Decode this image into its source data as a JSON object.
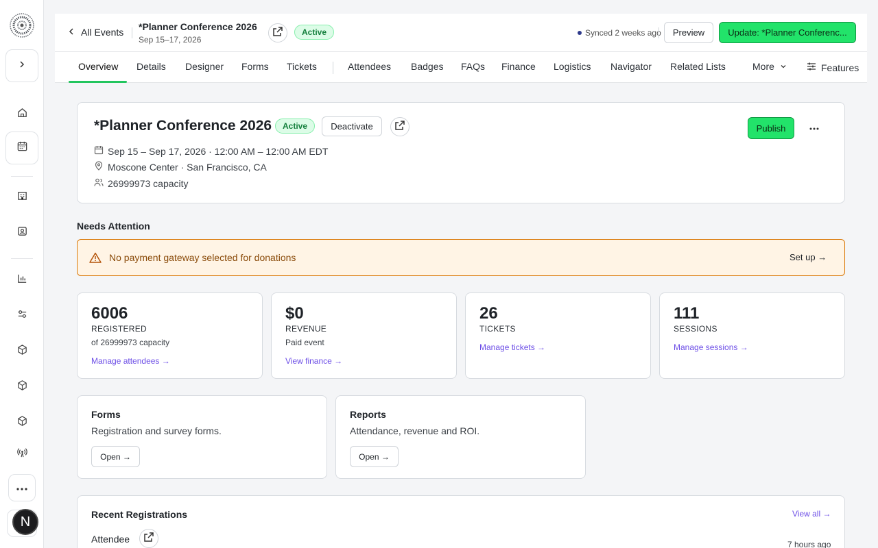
{
  "header": {
    "back_label": "All Events",
    "event_title": "*Planner Conference 2026",
    "event_dates": "Sep 15–17, 2026",
    "status": "Active",
    "synced": "Synced 2 weeks ago",
    "preview_label": "Preview",
    "update_label": "Update: *Planner Conferenc..."
  },
  "tabs": {
    "overview": "Overview",
    "details": "Details",
    "designer": "Designer",
    "forms": "Forms",
    "tickets": "Tickets",
    "attendees": "Attendees",
    "badges": "Badges",
    "faqs": "FAQs",
    "finance": "Finance",
    "logistics": "Logistics",
    "navigator": "Navigator",
    "related_lists": "Related Lists",
    "more": "More",
    "features": "Features"
  },
  "event_card": {
    "title": "*Planner Conference 2026",
    "status": "Active",
    "deactivate_label": "Deactivate",
    "publish_label": "Publish",
    "datetime": "Sep 15 – Sep 17, 2026 · 12:00 AM – 12:00 AM EDT",
    "location": "Moscone Center · San Francisco, CA",
    "capacity": "26999973 capacity"
  },
  "needs_attention": {
    "heading": "Needs Attention",
    "alert_text": "No payment gateway selected for donations",
    "alert_action": "Set up →"
  },
  "stats": [
    {
      "value": "6006",
      "label": "REGISTERED",
      "sub": "of 26999973 capacity",
      "link": "Manage attendees →"
    },
    {
      "value": "$0",
      "label": "REVENUE",
      "sub": "Paid event",
      "link": "View finance →"
    },
    {
      "value": "26",
      "label": "TICKETS",
      "sub": "",
      "link": "Manage tickets →"
    },
    {
      "value": "111",
      "label": "SESSIONS",
      "sub": "",
      "link": "Manage sessions →"
    }
  ],
  "modules": [
    {
      "title": "Forms",
      "desc": "Registration and survey forms.",
      "button": "Open →"
    },
    {
      "title": "Reports",
      "desc": "Attendance, revenue and ROI.",
      "button": "Open →"
    }
  ],
  "recent": {
    "title": "Recent Registrations",
    "view_all": "View all →",
    "rows": [
      {
        "name": "Attendee",
        "time": "7 hours ago"
      }
    ]
  },
  "sidebar": {
    "avatar_initial": "N"
  },
  "colors": {
    "accent_green": "#22e36a",
    "link_purple": "#6b4ce6",
    "alert_border": "#d97706"
  }
}
